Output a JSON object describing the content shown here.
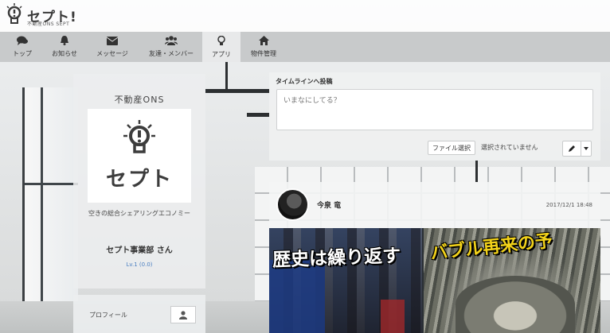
{
  "header": {
    "logo_text": "セプト!",
    "logo_sub": "不動産ONS SEPT"
  },
  "nav": {
    "items": [
      {
        "label": "トップ",
        "icon": "comments-icon"
      },
      {
        "label": "お知らせ",
        "icon": "bell-icon"
      },
      {
        "label": "メッセージ",
        "icon": "envelope-icon"
      },
      {
        "label": "友達・メンバー",
        "icon": "users-icon"
      },
      {
        "label": "アプリ",
        "icon": "lightbulb-icon",
        "active": true
      },
      {
        "label": "物件管理",
        "icon": "home-icon"
      }
    ]
  },
  "profile": {
    "title": "不動産ONS",
    "logo_text": "セプト",
    "description": "空きの総合シェアリングエコノミー",
    "name": "セプト事業部 さん",
    "level": "Lv.1 (0.0)",
    "profile_label": "プロフィール"
  },
  "post_form": {
    "label": "タイムラインへ投稿",
    "placeholder": "いまなにしてる？",
    "file_button": "ファイル選択",
    "file_status": "選択されていません"
  },
  "post": {
    "author": "今泉 竜",
    "date": "2017/12/1 18:48",
    "image_text_left": "歴史は繰り返す",
    "image_text_right": "バブル再来の予"
  },
  "colors": {
    "nav_bg": "#c3c5c6",
    "level_link": "#4a7fc1",
    "accent_yellow": "#f2d21a"
  }
}
